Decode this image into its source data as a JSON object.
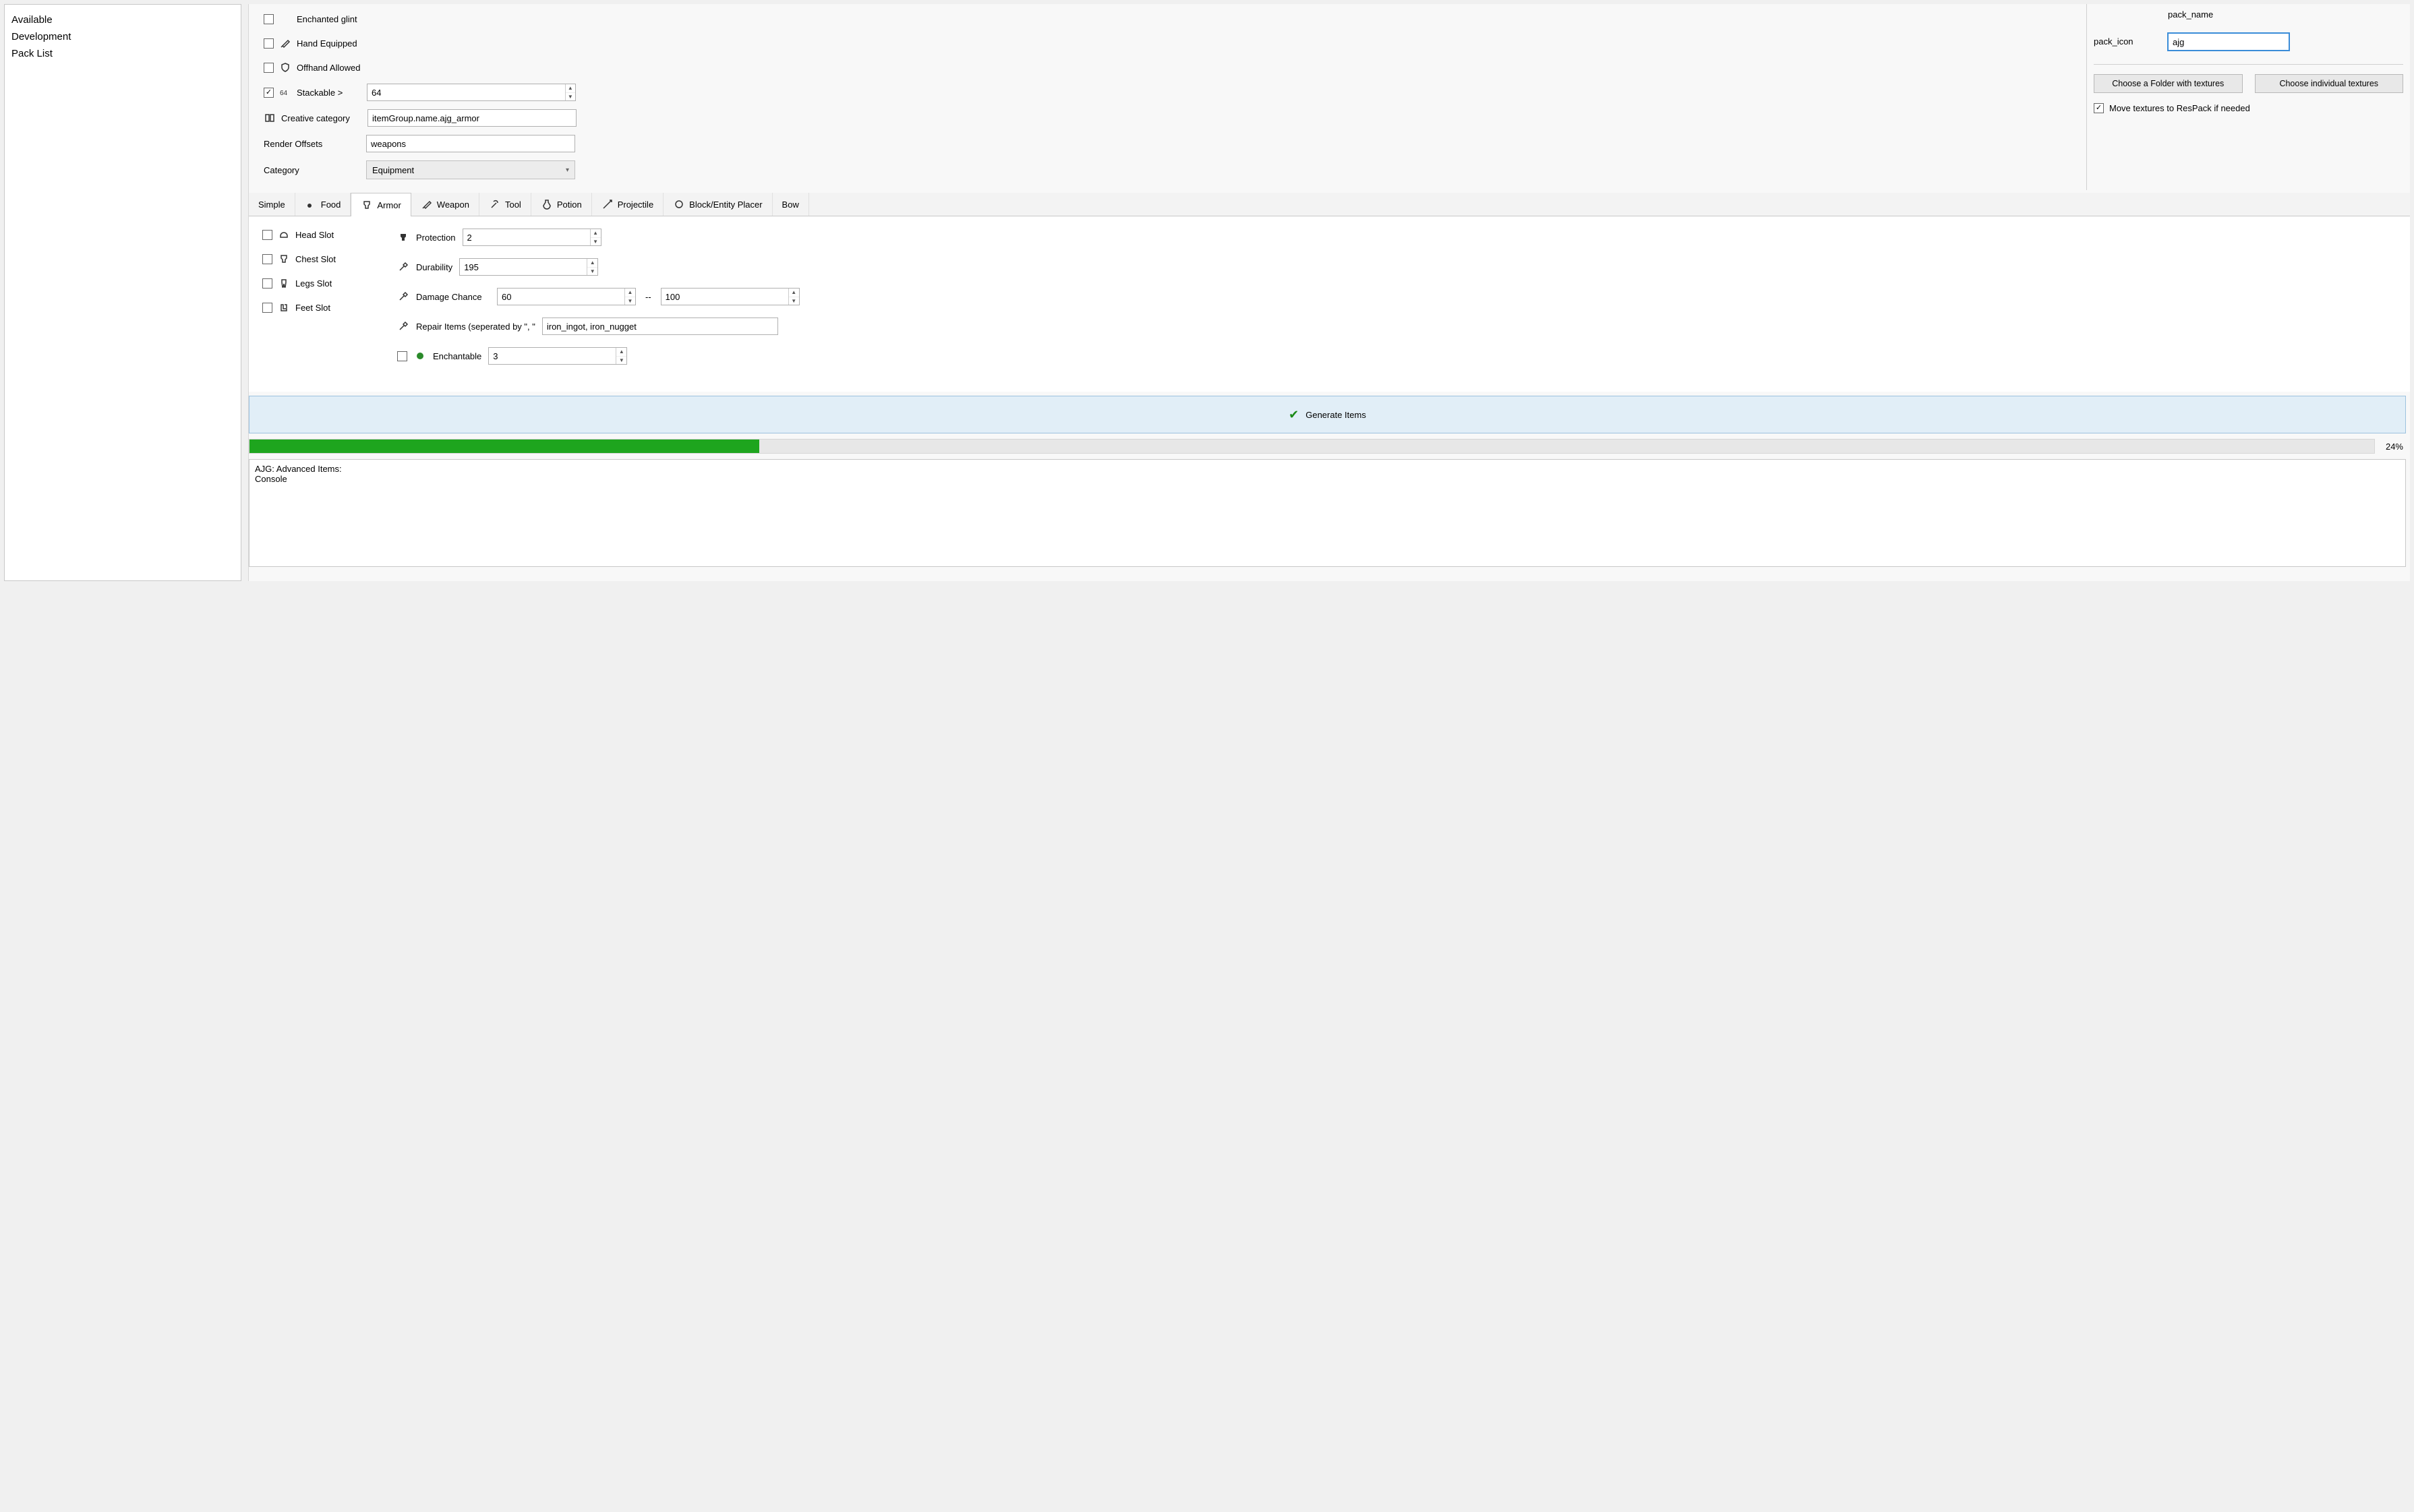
{
  "sidebar": {
    "items": [
      {
        "label": "Available"
      },
      {
        "label": "Development"
      },
      {
        "label": "Pack List"
      }
    ]
  },
  "options": {
    "enchanted_glint": {
      "label": "Enchanted glint",
      "checked": false
    },
    "hand_equipped": {
      "label": "Hand Equipped",
      "checked": false
    },
    "offhand_allowed": {
      "label": "Offhand Allowed",
      "checked": false
    },
    "stackable": {
      "label": "Stackable >",
      "checked": true,
      "value": "64"
    },
    "creative_category": {
      "label": "Creative category",
      "value": "itemGroup.name.ajg_armor"
    },
    "render_offsets": {
      "label": "Render Offsets",
      "value": "weapons"
    },
    "category": {
      "label": "Category",
      "value": "Equipment"
    }
  },
  "pack": {
    "icon_label": "pack_icon",
    "name_label": "pack_name",
    "name_value": "ajg",
    "choose_folder": "Choose a Folder with textures",
    "choose_individual": "Choose individual textures",
    "move_textures": {
      "label": "Move textures to ResPack if needed",
      "checked": true
    }
  },
  "tabs": [
    {
      "label": "Simple"
    },
    {
      "label": "Food"
    },
    {
      "label": "Armor",
      "active": true
    },
    {
      "label": "Weapon"
    },
    {
      "label": "Tool"
    },
    {
      "label": "Potion"
    },
    {
      "label": "Projectile"
    },
    {
      "label": "Block/Entity Placer"
    },
    {
      "label": "Bow"
    }
  ],
  "armor": {
    "slots": {
      "head": {
        "label": "Head Slot",
        "checked": false
      },
      "chest": {
        "label": "Chest Slot",
        "checked": false
      },
      "legs": {
        "label": "Legs Slot",
        "checked": false
      },
      "feet": {
        "label": "Feet Slot",
        "checked": false
      }
    },
    "protection": {
      "label": "Protection",
      "value": "2"
    },
    "durability": {
      "label": "Durability",
      "value": "195"
    },
    "damage_chance": {
      "label": "Damage Chance",
      "min": "60",
      "max": "100"
    },
    "repair_items": {
      "label": "Repair Items (seperated by \", \"",
      "value": "iron_ingot, iron_nugget"
    },
    "enchantable": {
      "label": "Enchantable",
      "checked": false,
      "value": "3"
    }
  },
  "generate": {
    "label": "Generate Items"
  },
  "progress": {
    "percent": 24,
    "label": "24%"
  },
  "console": {
    "text": "AJG: Advanced Items:\nConsole"
  }
}
